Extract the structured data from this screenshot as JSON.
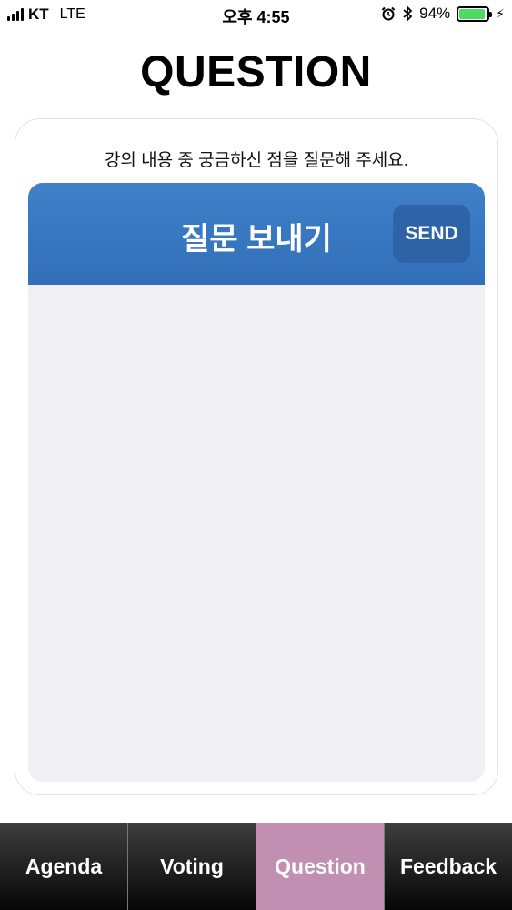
{
  "status_bar": {
    "carrier": "KT",
    "network": "LTE",
    "time": "오후 4:55",
    "battery_percent": "94%",
    "battery_level": 0.94,
    "icons": [
      "signal-icon",
      "alarm-icon",
      "bluetooth-icon",
      "battery-icon",
      "charging-icon"
    ]
  },
  "page": {
    "title": "QUESTION"
  },
  "card": {
    "instruction": "강의 내용 중 궁금하신 점을 질문해 주세요.",
    "composer_title": "질문 보내기",
    "send_label": "SEND",
    "input_value": "",
    "input_placeholder": ""
  },
  "tabs": [
    {
      "label": "Agenda",
      "active": false
    },
    {
      "label": "Voting",
      "active": false
    },
    {
      "label": "Question",
      "active": true
    },
    {
      "label": "Feedback",
      "active": false
    }
  ],
  "colors": {
    "header_blue": "#3a7ac2",
    "send_button": "#2f63a8",
    "active_tab": "#c08fb2",
    "tab_bar": "#222222",
    "battery_green": "#4cd964"
  }
}
